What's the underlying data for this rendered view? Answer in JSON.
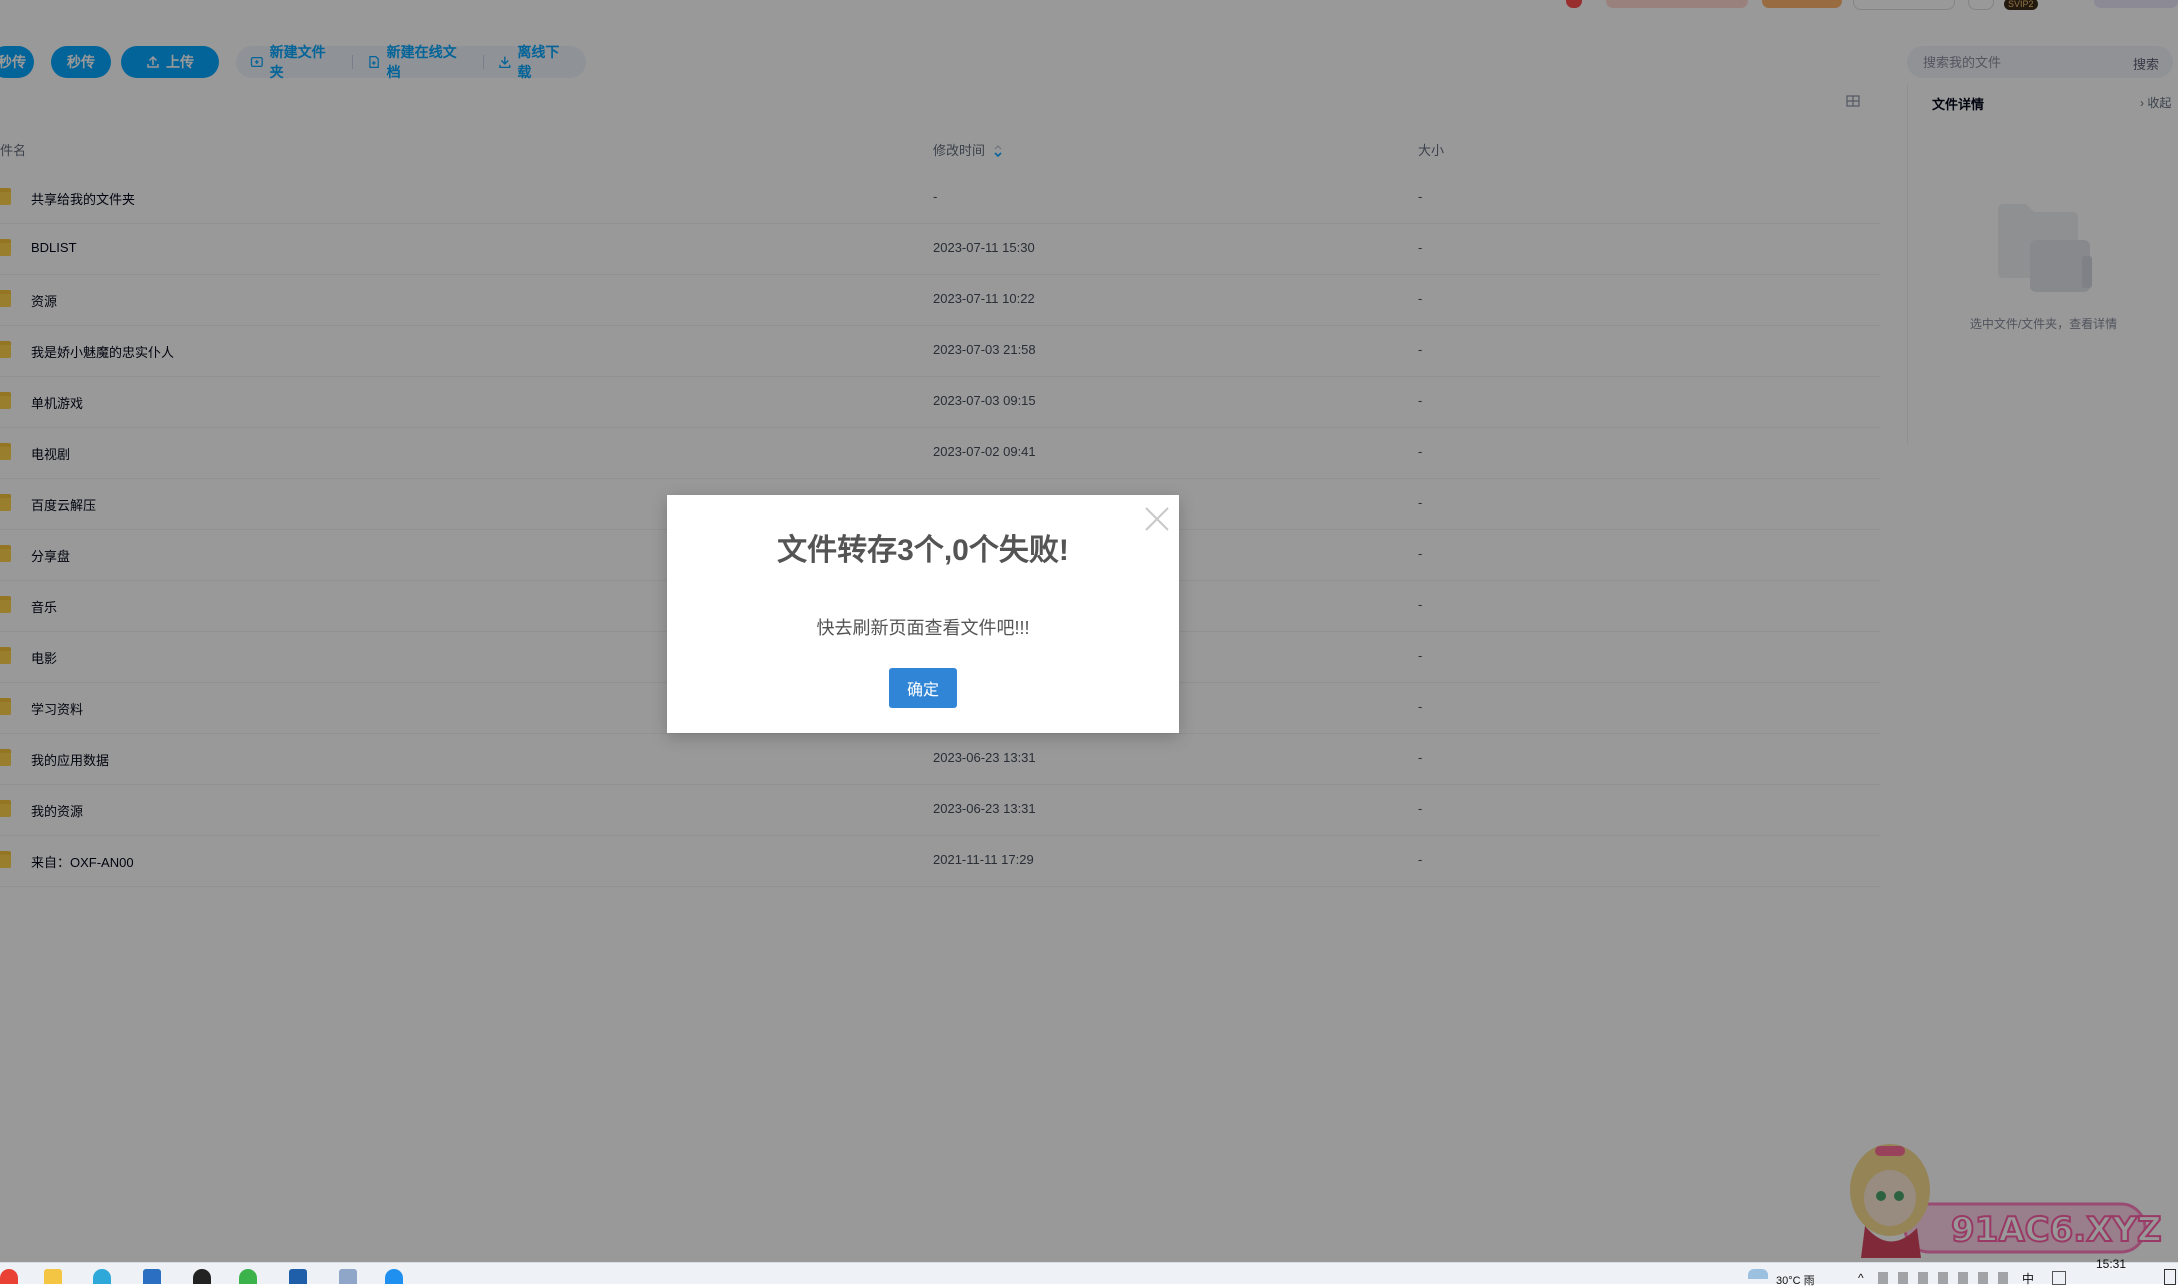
{
  "toolbar": {
    "btn_partial": "秒传",
    "btn_instant": "秒传",
    "btn_upload": "上传",
    "new_folder": "新建文件夹",
    "new_online_doc": "新建在线文档",
    "offline_download": "离线下载"
  },
  "header": {
    "badge": "SVIP2"
  },
  "search": {
    "placeholder": "搜索我的文件",
    "button": "搜索"
  },
  "table": {
    "columns": {
      "name": "件名",
      "modified": "修改时间",
      "size": "大小"
    },
    "rows": [
      {
        "name": "共享给我的文件夹",
        "modified": "-",
        "size": "-"
      },
      {
        "name": "BDLIST",
        "modified": "2023-07-11 15:30",
        "size": "-"
      },
      {
        "name": "资源",
        "modified": "2023-07-11 10:22",
        "size": "-"
      },
      {
        "name": "我是娇小魅魔的忠实仆人",
        "modified": "2023-07-03 21:58",
        "size": "-"
      },
      {
        "name": "单机游戏",
        "modified": "2023-07-03 09:15",
        "size": "-"
      },
      {
        "name": "电视剧",
        "modified": "2023-07-02 09:41",
        "size": "-"
      },
      {
        "name": "百度云解压",
        "modified": "",
        "size": "-"
      },
      {
        "name": "分享盘",
        "modified": "",
        "size": "-"
      },
      {
        "name": "音乐",
        "modified": "",
        "size": "-"
      },
      {
        "name": "电影",
        "modified": "",
        "size": "-"
      },
      {
        "name": "学习资料",
        "modified": "",
        "size": "-"
      },
      {
        "name": "我的应用数据",
        "modified": "2023-06-23 13:31",
        "size": "-"
      },
      {
        "name": "我的资源",
        "modified": "2023-06-23 13:31",
        "size": "-"
      },
      {
        "name": "来自：OXF-AN00",
        "modified": "2021-11-11 17:29",
        "size": "-"
      }
    ]
  },
  "detail_panel": {
    "title": "文件详情",
    "collapse": "收起",
    "hint": "选中文件/文件夹，查看详情"
  },
  "modal": {
    "title": "文件转存3个,0个失败!",
    "message": "快去刷新页面查看文件吧!!!",
    "confirm": "确定"
  },
  "taskbar": {
    "weather": "30°C 雨",
    "ime": "中",
    "time": "15:31"
  },
  "watermark": {
    "text": "91AC6.XYZ"
  },
  "colors": {
    "primary": "#06a7ff",
    "modal_button": "#3085d6",
    "folder": "#f5c33b",
    "overlay": "rgba(0,0,0,0.4)"
  }
}
